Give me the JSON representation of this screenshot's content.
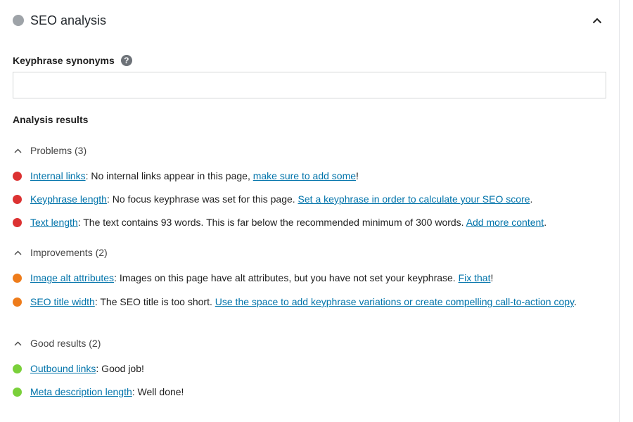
{
  "panel": {
    "title": "SEO analysis",
    "status_color": "#9ea3a8",
    "collapse_icon": "chevron-up-icon"
  },
  "synonyms": {
    "label": "Keyphrase synonyms",
    "help_glyph": "?",
    "value": "",
    "placeholder": ""
  },
  "analysis": {
    "heading": "Analysis results"
  },
  "groups": {
    "problems": {
      "label": "Problems (3)",
      "color": "#dc3232",
      "items": [
        {
          "link": "Internal links",
          "text": ": No internal links appear in this page, ",
          "action": "make sure to add some",
          "end": "!"
        },
        {
          "link": "Keyphrase length",
          "text": ": No focus keyphrase was set for this page. ",
          "action": "Set a keyphrase in order to calculate your SEO score",
          "end": "."
        },
        {
          "link": "Text length",
          "text": ": The text contains 93 words. This is far below the recommended minimum of 300 words. ",
          "action": "Add more content",
          "end": "."
        }
      ]
    },
    "improvements": {
      "label": "Improvements (2)",
      "color": "#ee7c1b",
      "items": [
        {
          "link": "Image alt attributes",
          "text": ": Images on this page have alt attributes, but you have not set your keyphrase. ",
          "action": "Fix that",
          "end": "!"
        },
        {
          "link": "SEO title width",
          "text": ": The SEO title is too short. ",
          "action": "Use the space to add keyphrase variations or create compelling call-to-action copy",
          "end": "."
        }
      ]
    },
    "good": {
      "label": "Good results (2)",
      "color": "#7ad03a",
      "items": [
        {
          "link": "Outbound links",
          "text": ": Good job!"
        },
        {
          "link": "Meta description length",
          "text": ": Well done!"
        }
      ]
    }
  }
}
